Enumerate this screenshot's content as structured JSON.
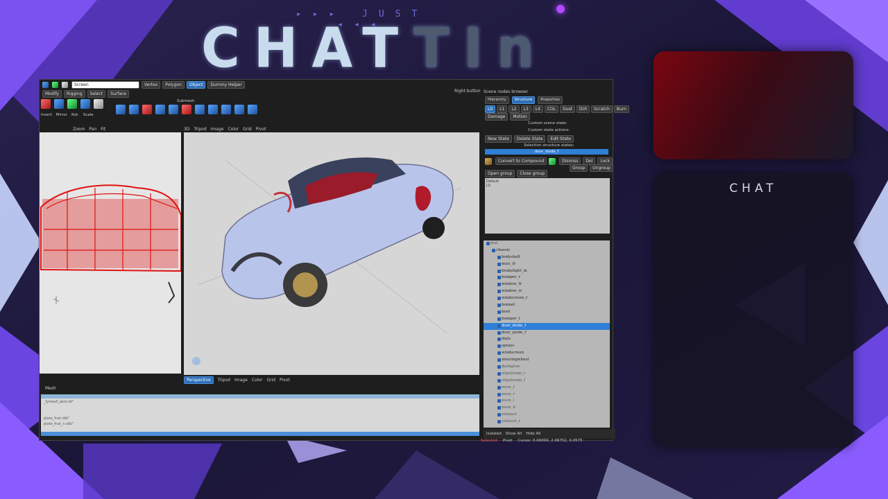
{
  "overlay": {
    "tagline": "JUST",
    "title_main": "CHAT",
    "title_tail": "TIn",
    "chat_label": "CHAT"
  },
  "editor": {
    "menu": {
      "screen_field": "Screen",
      "vertex": "Vertex",
      "polygon": "Polygon",
      "object": "Object",
      "dummy_helper": "Dummy Helper",
      "right_button": "Right button"
    },
    "tabs": [
      "Modify",
      "Rigging",
      "Select",
      "Surface"
    ],
    "left_tools": [
      "Insert",
      "Mirror",
      "Rot.",
      "Scale"
    ],
    "submesh_label": "Submesh",
    "viewport_bar_top": [
      "Zoom",
      "Pan",
      "Fit"
    ],
    "viewport_main_bar": [
      "3D",
      "Tripod",
      "Image",
      "Color",
      "Grid",
      "Pivot"
    ],
    "viewport_bottom_bar": [
      "Perspective",
      "Tripod",
      "Image",
      "Color",
      "Grid",
      "Pivot"
    ],
    "mesh_tab": "Mesh",
    "console_lines": [
      "_fynwall_qsco.tb\"",
      "plate_fnxt.tdb\"",
      "plate_fnxt_n.tdb\""
    ],
    "scene_browser_title": "Scene nodes browser",
    "scene_tabs": [
      "Hierarchy",
      "Structure",
      "Properties"
    ],
    "lod_buttons": [
      "L0",
      "L1",
      "L2",
      "L3",
      "L4",
      "COL",
      "Dust",
      "Dirt",
      "Scratch",
      "Burn"
    ],
    "dropdowns": [
      "Damage",
      "Motion"
    ],
    "custom_scene_state": "Custom scene state:",
    "custom_state_actions": "Custom state actions:",
    "state_buttons": [
      "New State",
      "Delete State",
      "Edit State"
    ],
    "selection_states": "Selection structure states:",
    "selected_state": "door_dside_f",
    "convert_button": "Convert to Compound",
    "dismiss_button": "Dismiss",
    "del_button": "Del",
    "lock_button": "Lock",
    "group_button": "Group",
    "ungroup_button": "Ungroup",
    "open_group": "Open group",
    "close_group": "Close group",
    "state_box_lines": [
      "Default",
      "L0"
    ],
    "hierarchy": [
      {
        "label": "dod",
        "depth": 0,
        "state": "faded"
      },
      {
        "label": "chassis",
        "depth": 1,
        "state": "normal"
      },
      {
        "label": "bodyshell",
        "depth": 2,
        "state": "normal"
      },
      {
        "label": "misc_fr",
        "depth": 2,
        "state": "normal"
      },
      {
        "label": "brakelight_m",
        "depth": 2,
        "state": "normal"
      },
      {
        "label": "bumper_r",
        "depth": 2,
        "state": "normal"
      },
      {
        "label": "window_fr",
        "depth": 2,
        "state": "normal"
      },
      {
        "label": "window_rr",
        "depth": 2,
        "state": "normal"
      },
      {
        "label": "windscreen_r",
        "depth": 2,
        "state": "normal"
      },
      {
        "label": "bonnet",
        "depth": 2,
        "state": "normal"
      },
      {
        "label": "boot",
        "depth": 2,
        "state": "normal"
      },
      {
        "label": "bumper_f",
        "depth": 2,
        "state": "normal"
      },
      {
        "label": "door_dside_f",
        "depth": 2,
        "state": "selected"
      },
      {
        "label": "door_pside_f",
        "depth": 2,
        "state": "normal"
      },
      {
        "label": "dials",
        "depth": 2,
        "state": "normal"
      },
      {
        "label": "sprays",
        "depth": 2,
        "state": "normal"
      },
      {
        "label": "windscreen",
        "depth": 2,
        "state": "normal"
      },
      {
        "label": "steeringwheel",
        "depth": 2,
        "state": "normal"
      },
      {
        "label": "dashglow",
        "depth": 2,
        "state": "faded"
      },
      {
        "label": "slipstream_r",
        "depth": 2,
        "state": "faded"
      },
      {
        "label": "slipstream_f",
        "depth": 2,
        "state": "faded"
      },
      {
        "label": "neon_f",
        "depth": 2,
        "state": "faded"
      },
      {
        "label": "neon_r",
        "depth": 2,
        "state": "faded"
      },
      {
        "label": "neon_l",
        "depth": 2,
        "state": "faded"
      },
      {
        "label": "neon_b",
        "depth": 2,
        "state": "faded"
      },
      {
        "label": "exhaust",
        "depth": 2,
        "state": "faded"
      },
      {
        "label": "exhaust_r",
        "depth": 2,
        "state": "faded"
      }
    ],
    "status": {
      "isolated": "Isolated",
      "show_all": "Show All",
      "hide_all": "Hide All",
      "selected": "Selected",
      "pivot": "Pivot",
      "cursor": "Cursor: 0.00000, 2.06752, 0.0575"
    }
  },
  "colors": {
    "accent_purple": "#7b5cff",
    "selection_blue": "#2f7fd6",
    "wireframe_red": "#e01010",
    "car_body": "#b9c4ea"
  }
}
